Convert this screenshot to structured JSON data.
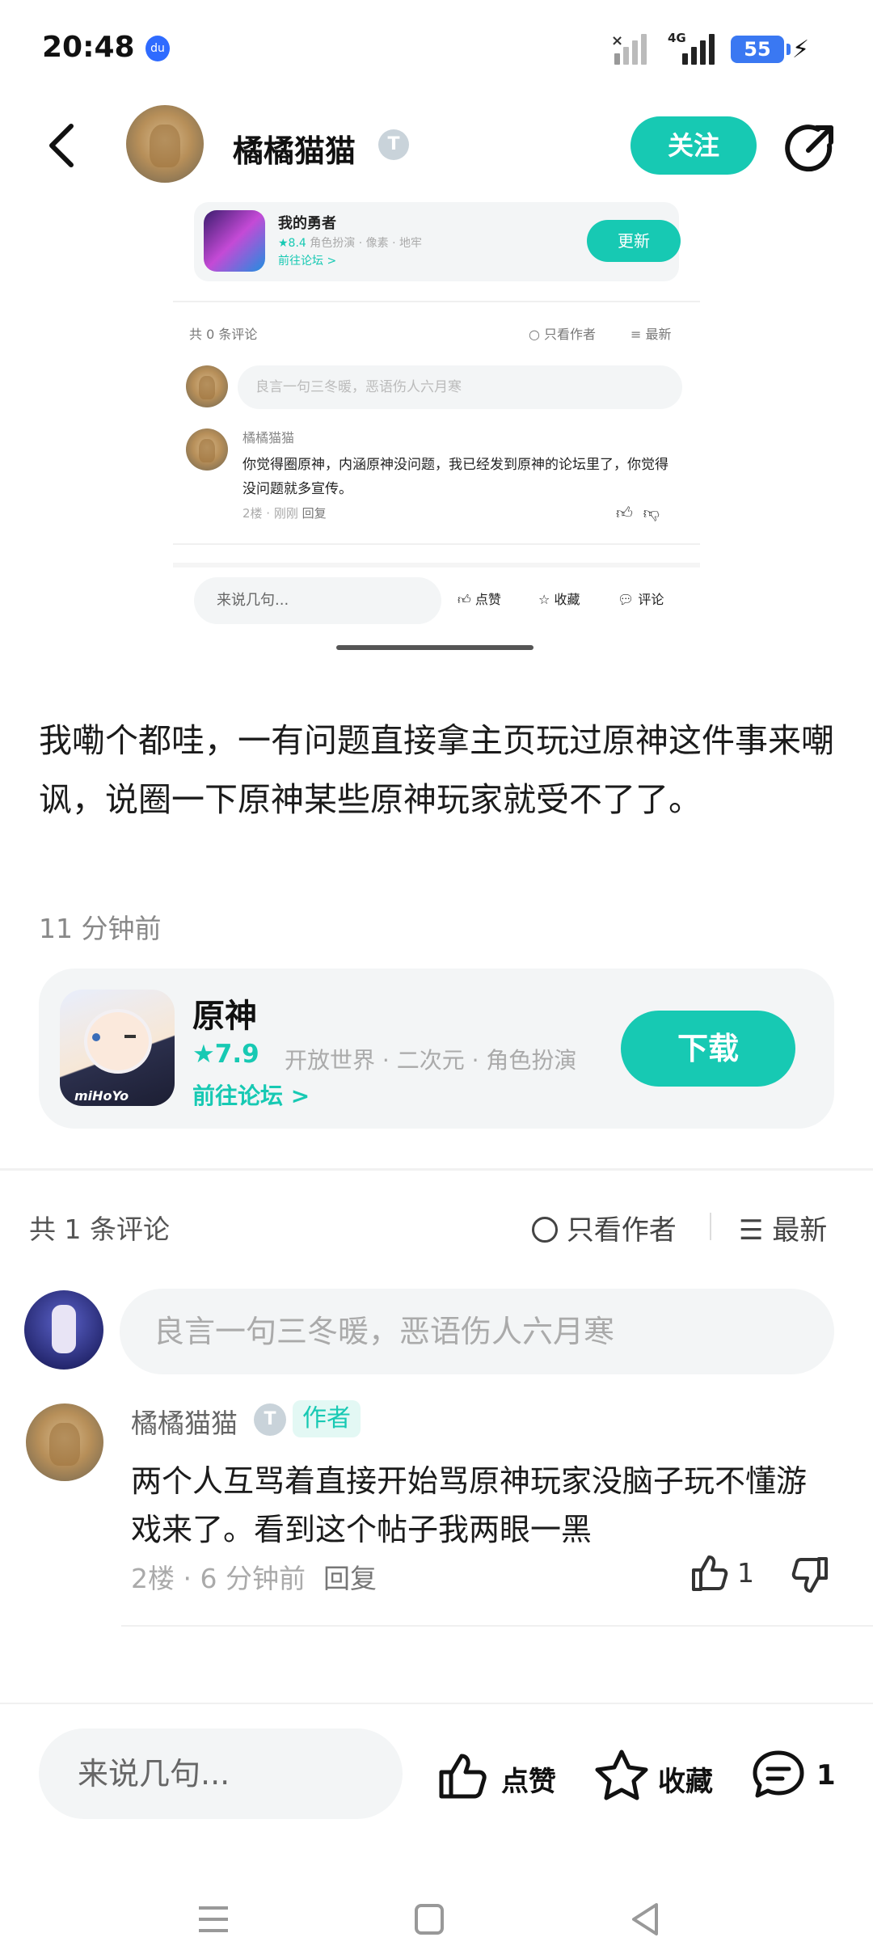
{
  "status": {
    "time": "20:48",
    "network": "4G",
    "battery": "55"
  },
  "header": {
    "username": "橘橘猫猫",
    "badge": "T",
    "follow_label": "关注"
  },
  "screenshot": {
    "game": {
      "name": "我的勇者",
      "rating": "★8.4",
      "tags": "角色扮演 · 像素 · 地牢",
      "forum_link": "前往论坛 >",
      "update_label": "更新"
    },
    "comment_count": "共 0 条评论",
    "only_author": "只看作者",
    "sort": "最新",
    "input_placeholder": "良言一句三冬暖，恶语伤人六月寒",
    "comment": {
      "user": "橘橘猫猫",
      "text": "你觉得圈原神，内涵原神没问题，我已经发到原神的论坛里了，你觉得没问题就多宣传。",
      "meta": "2楼 · 刚刚",
      "reply": "回复"
    },
    "bottom": {
      "input": "来说几句...",
      "like": "点赞",
      "fav": "收藏",
      "comment": "评论"
    }
  },
  "post": {
    "text": "我嘞个都哇，一有问题直接拿主页玩过原神这件事来嘲讽，说圈一下原神某些原神玩家就受不了了。",
    "time": "11 分钟前"
  },
  "game_card": {
    "name": "原神",
    "rating": "7.9",
    "tags": "开放世界 · 二次元 · 角色扮演",
    "forum_link": "前往论坛 >",
    "download_label": "下载",
    "publisher": "miHoYo"
  },
  "comments": {
    "count_label": "共 1 条评论",
    "only_author": "只看作者",
    "sort": "最新",
    "input_placeholder": "良言一句三冬暖，恶语伤人六月寒",
    "items": [
      {
        "user": "橘橘猫猫",
        "author_tag": "作者",
        "text": "两个人互骂着直接开始骂原神玩家没脑子玩不懂游戏来了。看到这个帖子我两眼一黑",
        "meta": "2楼 · 6 分钟前",
        "reply": "回复",
        "likes": "1"
      }
    ]
  },
  "bottom_bar": {
    "input_placeholder": "来说几句...",
    "like_label": "点赞",
    "fav_label": "收藏",
    "comment_count": "1"
  },
  "colors": {
    "accent": "#17c9b3",
    "battery": "#3a78f2"
  }
}
